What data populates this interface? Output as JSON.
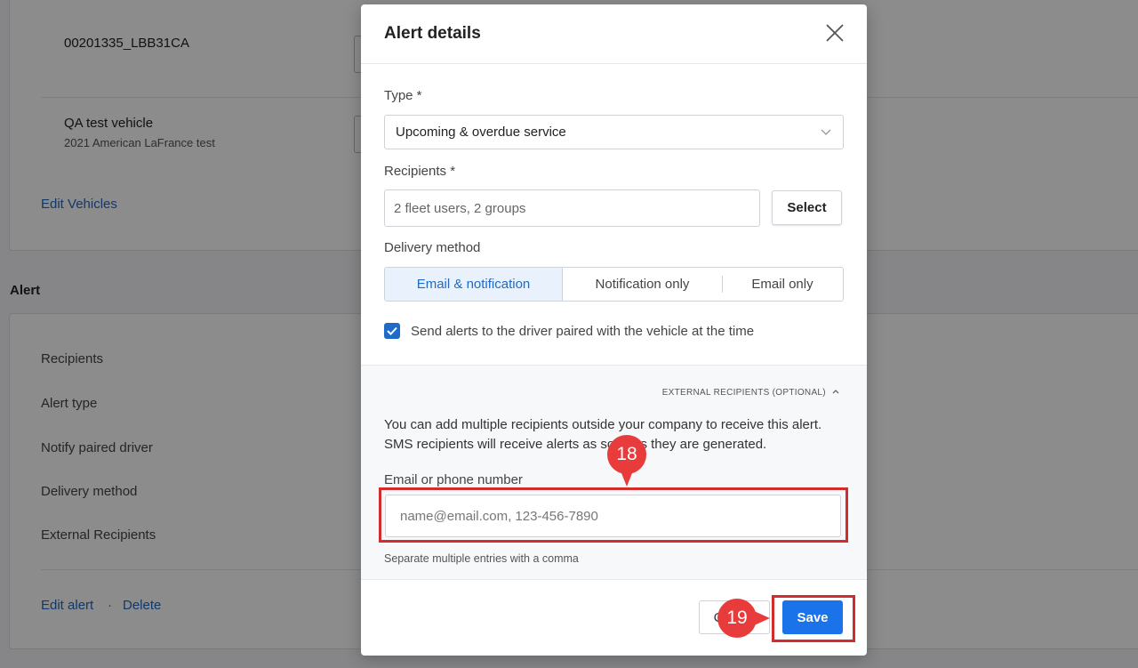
{
  "background": {
    "vehicles": [
      {
        "name": "00201335_LBB31CA",
        "subtitle": ""
      },
      {
        "name": "QA test vehicle",
        "subtitle": "2021 American LaFrance test"
      }
    ],
    "edit_vehicles_link": "Edit Vehicles",
    "alert_section_title": "Alert",
    "alert_labels": [
      "Recipients",
      "Alert type",
      "Notify paired driver",
      "Delivery method",
      "External Recipients"
    ],
    "edit_alert_link": "Edit alert",
    "link_separator": "·",
    "delete_link": "Delete"
  },
  "modal": {
    "title": "Alert details",
    "close_icon": "close-icon",
    "type": {
      "label": "Type *",
      "value": "Upcoming & overdue service"
    },
    "recipients": {
      "label": "Recipients *",
      "value": "2 fleet users, 2 groups",
      "select_button": "Select"
    },
    "delivery": {
      "label": "Delivery method",
      "options": [
        "Email & notification",
        "Notification only",
        "Email only"
      ],
      "selected": "Email & notification"
    },
    "send_to_driver": {
      "label": "Send alerts to the driver paired with the vehicle at the time",
      "checked": true
    },
    "external": {
      "toggle_label": "EXTERNAL RECIPIENTS (OPTIONAL)",
      "description": "You can add multiple recipients outside your company to receive this alert. SMS recipients will receive alerts as soon as they are generated.",
      "field_label": "Email or phone number",
      "placeholder": "name@email.com, 123-456-7890",
      "hint": "Separate multiple entries with a comma"
    },
    "footer": {
      "cancel_label": "Cancel",
      "save_label": "Save"
    }
  },
  "annotations": {
    "step_18": "18",
    "step_19": "19",
    "highlight_color": "#d32c2c",
    "marker_color": "#e83c3c"
  },
  "colors": {
    "accent": "#1a73e8",
    "link": "#2367c2"
  }
}
